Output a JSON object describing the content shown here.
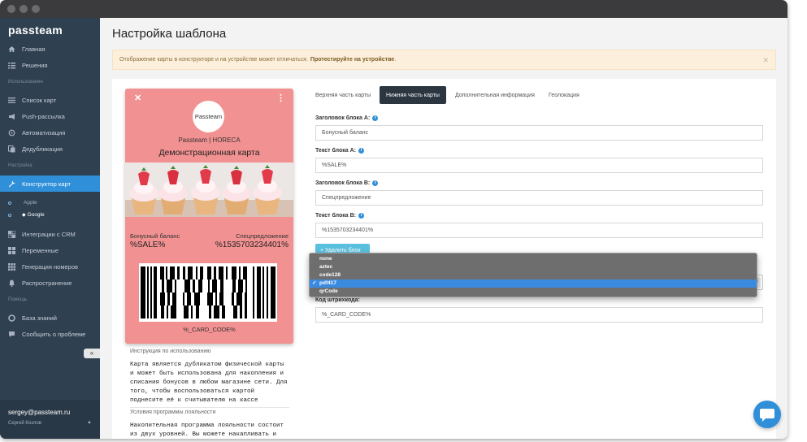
{
  "sidebar": {
    "logo": "passteam",
    "items": [
      {
        "label": "Главная",
        "icon": "home-icon"
      },
      {
        "label": "Решения",
        "icon": "list-icon"
      }
    ],
    "section_usage": "Использование",
    "usage_items": [
      {
        "label": "Список карт",
        "icon": "cards-icon"
      },
      {
        "label": "Push-рассылка",
        "icon": "megaphone-icon"
      },
      {
        "label": "Автоматизация",
        "icon": "refresh-icon"
      },
      {
        "label": "Дедубликация",
        "icon": "copy-icon"
      }
    ],
    "section_settings": "Настройка",
    "active_item": {
      "label": "Конструктор карт",
      "icon": "wrench-icon"
    },
    "sub_items": [
      {
        "label": "Apple",
        "glyph": ""
      },
      {
        "label": "Google",
        "glyph": "◆"
      }
    ],
    "settings_items": [
      {
        "label": "Интеграции с CRM",
        "icon": "integration-icon"
      },
      {
        "label": "Переменные",
        "icon": "grid-icon"
      },
      {
        "label": "Генерация номеров",
        "icon": "barcode-icon"
      },
      {
        "label": "Распространение",
        "icon": "bell-icon"
      }
    ],
    "section_help": "Помощь",
    "help_items": [
      {
        "label": "База знаний",
        "icon": "lifebuoy-icon"
      },
      {
        "label": "Сообщить о проблеме",
        "icon": "chat-icon"
      }
    ],
    "user_email": "sergey@passteam.ru",
    "user_name": "Сергей Козлов"
  },
  "page": {
    "title": "Настройка шаблона",
    "alert_text": "Отображение карты в конструкторе и на устройстве может отличаться.",
    "alert_link": "Протестируйте на устройстве",
    "alert_end": "."
  },
  "card": {
    "logo_text": "Passteam",
    "org": "Passteam | HORECA",
    "title": "Демонстрационная карта",
    "field_a_label": "Бонусный баланс",
    "field_a_value": "%SALE%",
    "field_b_label": "Спецпредложение",
    "field_b_value": "%1535703234401%",
    "code_text": "%_CARD_CODE%",
    "accent": "#f29191"
  },
  "instructions": {
    "label": "Инструкция по использованию",
    "text": "Карта является дубликатом физической карты и может быть использована для накопления и списания бонусов в любом магазине сети. Для того, чтобы воспользоваться картой поднесите её к считывателю на кассе",
    "cond_label": "Условия программы лояльности",
    "cond_text": "Накопительная программа лояльности состоит из двух уровней. Вы можете накапливать и"
  },
  "tabs": [
    "Верхняя часть карты",
    "Нижняя часть карты",
    "Дополнительная информация",
    "Геолокация"
  ],
  "form": {
    "label_a_title": "Заголовок блока A:",
    "value_a_title": "Бонусный баланс",
    "label_a_text": "Текст блока A:",
    "value_a_text": "%SALE%",
    "label_b_title": "Заголовок блока B:",
    "value_b_title": "Спецпредложение",
    "label_b_text": "Текст блока B:",
    "value_b_text": "%1535703234401%",
    "add_button": "+ Удалить блок",
    "barcode_label": "Код штрихкода:",
    "barcode_value": "%_CARD_CODE%"
  },
  "barcode_dropdown": {
    "options": [
      "none",
      "aztec",
      "code128",
      "pdf417",
      "qrCode"
    ],
    "selected": "pdf417",
    "check": "✓"
  },
  "colors": {
    "sidebar": "#2f4050",
    "active": "#2f8fd8",
    "alert_bg": "#fcf0dc"
  }
}
